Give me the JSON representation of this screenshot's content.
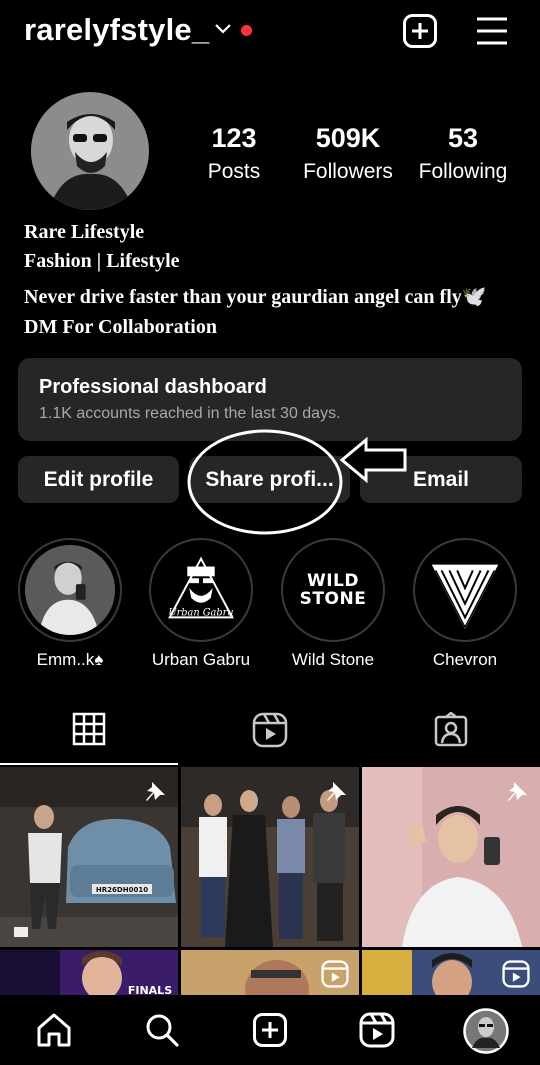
{
  "header": {
    "username": "rarelyfstyle_",
    "dropdown_icon": "chevron-down-icon",
    "notification_dot_color": "#ff3040",
    "create_icon": "plus-square-icon",
    "menu_icon": "hamburger-menu-icon"
  },
  "profile": {
    "stats": [
      {
        "value": "123",
        "label": "Posts"
      },
      {
        "value": "509K",
        "label": "Followers"
      },
      {
        "value": "53",
        "label": "Following"
      }
    ],
    "bio": [
      "Rare Lifestyle",
      "Fashion | Lifestyle",
      "Never drive faster than your gaurdian angel can fly🕊️",
      "DM For Collaboration"
    ]
  },
  "dashboard": {
    "title": "Professional dashboard",
    "subtitle": "1.1K accounts reached in the last 30 days."
  },
  "buttons": {
    "edit": "Edit profile",
    "share": "Share profi...",
    "email": "Email"
  },
  "highlights": [
    {
      "label": "Emm..k♠"
    },
    {
      "label": "Urban Gabru",
      "logo_text": "Urban Gabru"
    },
    {
      "label": "Wild Stone",
      "logo_text": "WILD STONE"
    },
    {
      "label": "Chevron"
    }
  ],
  "tabs": [
    {
      "icon": "grid-icon",
      "active": true
    },
    {
      "icon": "reels-icon",
      "active": false
    },
    {
      "icon": "tagged-icon",
      "active": false
    }
  ],
  "grid": {
    "car_plate": "HR26DH0010",
    "pinned_icon": "pin-icon",
    "reel_icon": "reels-icon",
    "finals_text": "FINALS"
  },
  "bottom_nav": [
    {
      "icon": "home-icon"
    },
    {
      "icon": "search-icon"
    },
    {
      "icon": "create-icon"
    },
    {
      "icon": "reels-icon"
    },
    {
      "icon": "profile-avatar"
    }
  ]
}
